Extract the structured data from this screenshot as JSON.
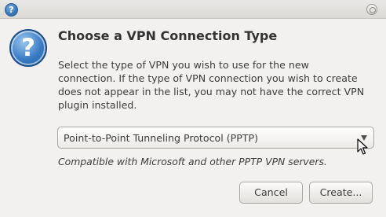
{
  "titlebar": {
    "app_icon_glyph": "?",
    "app_icon": "help-question-icon",
    "close_icon": "close-icon"
  },
  "dialog": {
    "icon": "help-question-icon",
    "icon_glyph": "?",
    "title": "Choose a VPN Connection Type",
    "description_lines": [
      "Select the type of VPN you wish to use for the new",
      "connection.  If the type of VPN connection you wish to create",
      "does not appear in the list, you may not have the correct VPN",
      "plugin installed."
    ],
    "vpn_type": {
      "selected": "Point-to-Point Tunneling Protocol (PPTP)",
      "note": "Compatible with Microsoft and other PPTP VPN servers."
    },
    "buttons": {
      "cancel": "Cancel",
      "create": "Create..."
    }
  },
  "colors": {
    "background": "#f2f1f0",
    "icon_blue": "#3a7cc4",
    "text": "#3c3c3c"
  }
}
